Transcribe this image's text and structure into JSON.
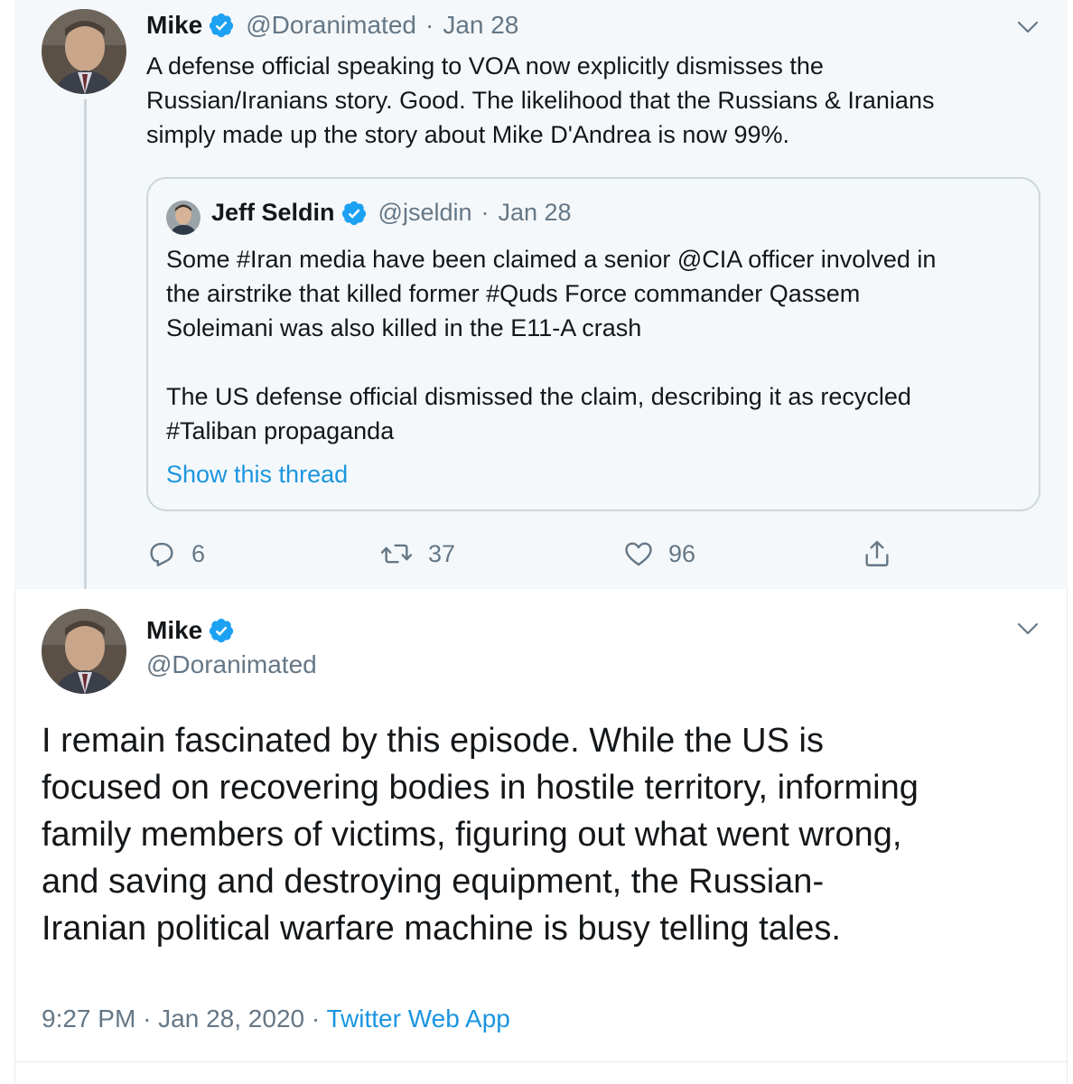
{
  "tweet1": {
    "author_name": "Mike",
    "handle": "@Doranimated",
    "separator": "·",
    "date": "Jan 28",
    "text_lines": [
      "A defense official speaking to VOA now explicitly dismisses the",
      "Russian/Iranians story. Good. The likelihood that the Russians & Iranians",
      "simply made up the story about Mike D'Andrea is now 99%."
    ],
    "quoted": {
      "author_name": "Jeff Seldin",
      "handle": "@jseldin",
      "separator": "·",
      "date": "Jan 28",
      "paragraph1_lines": [
        "Some #Iran media have been claimed a senior @CIA officer involved in",
        "the airstrike that killed former #Quds Force commander Qassem",
        "Soleimani was also killed in the E11-A crash"
      ],
      "paragraph2_lines": [
        "The US defense official dismissed the claim, describing it as recycled",
        "#Taliban propaganda"
      ],
      "show_thread_label": "Show this thread"
    },
    "actions": {
      "reply_count": "6",
      "retweet_count": "37",
      "like_count": "96"
    }
  },
  "tweet2": {
    "author_name": "Mike",
    "handle": "@Doranimated",
    "text_lines": [
      "I remain fascinated by this episode. While the US is",
      "focused on recovering bodies in hostile territory, informing",
      "family members of victims, figuring out what went wrong,",
      "and saving and destroying equipment, the Russian-",
      "Iranian political warfare machine is busy telling tales."
    ],
    "time": "9:27 PM",
    "separator1": "·",
    "date": "Jan 28, 2020",
    "separator2": "·",
    "source_app": "Twitter Web App"
  },
  "colors": {
    "accent": "#1da1f2",
    "link": "#1b95e0",
    "muted_text": "#657786",
    "thread_background": "#f5f8fa",
    "border": "#ccd6dd"
  },
  "icons": {
    "verified": "verified-badge-icon",
    "chevron": "chevron-down-icon",
    "reply": "reply-icon",
    "retweet": "retweet-icon",
    "like": "heart-icon",
    "share": "share-icon"
  }
}
